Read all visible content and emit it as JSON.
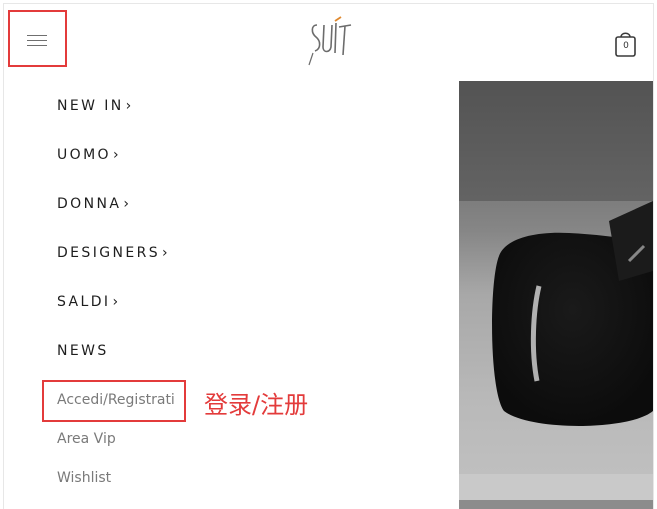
{
  "header": {
    "logo_text": "SUIT",
    "cart_count": "0"
  },
  "nav": {
    "items": [
      {
        "label": "NEW IN",
        "has_chevron": true
      },
      {
        "label": "UOMO",
        "has_chevron": true
      },
      {
        "label": "DONNA",
        "has_chevron": true
      },
      {
        "label": "DESIGNERS",
        "has_chevron": true
      },
      {
        "label": "SALDI",
        "has_chevron": true
      },
      {
        "label": "NEWS",
        "has_chevron": false
      }
    ],
    "chevron": "›",
    "account_links": [
      {
        "label": "Accedi/Registrati"
      },
      {
        "label": "Area Vip"
      },
      {
        "label": "Wishlist"
      }
    ]
  },
  "annotation": {
    "text": "登录/注册",
    "color": "#e33b3b"
  },
  "icons": [
    "hamburger-menu-icon",
    "shopping-bag-icon",
    "chevron-right-icon"
  ]
}
